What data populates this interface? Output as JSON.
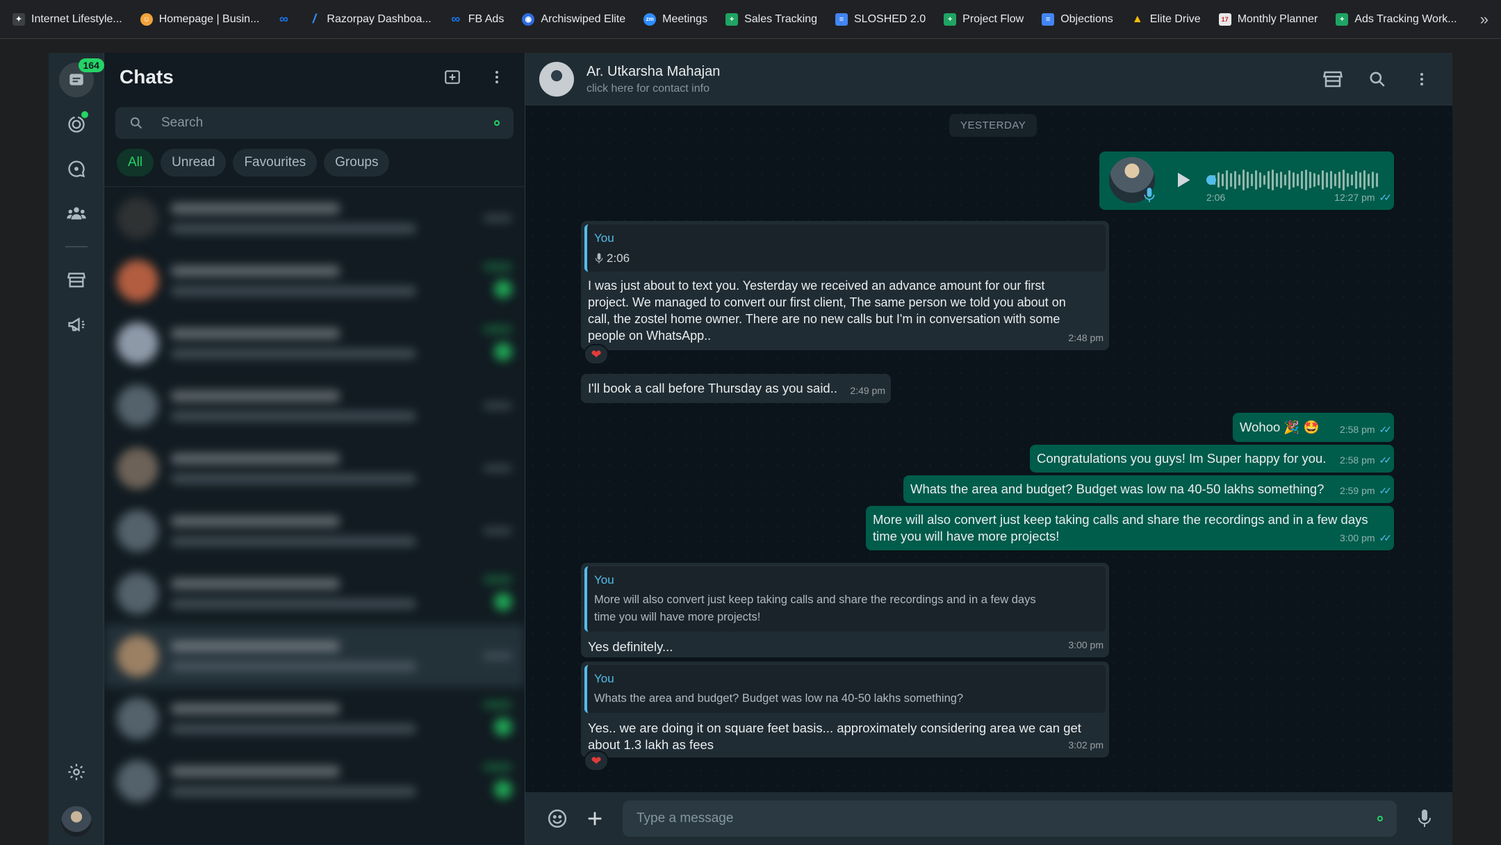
{
  "bookmarks": [
    {
      "label": "Internet Lifestyle...",
      "icon": "bird-icon",
      "color": "#5f6368"
    },
    {
      "label": "Homepage | Busin...",
      "icon": "face-icon",
      "color": "#f2a33a"
    },
    {
      "label": "",
      "icon": "meta-icon",
      "color": "#1877f2"
    },
    {
      "label": "Razorpay Dashboa...",
      "icon": "razorpay-icon",
      "color": "#3395ff"
    },
    {
      "label": "FB Ads",
      "icon": "meta-icon",
      "color": "#1877f2"
    },
    {
      "label": "Archiswiped Elite",
      "icon": "circle-logo-icon",
      "color": "#2d6cdf"
    },
    {
      "label": "Meetings",
      "icon": "zoom-icon",
      "color": "#2d8cff"
    },
    {
      "label": "Sales Tracking",
      "icon": "sheets-icon",
      "color": "#1fa463"
    },
    {
      "label": "SLOSHED 2.0",
      "icon": "docs-icon",
      "color": "#4285f4"
    },
    {
      "label": "Project Flow",
      "icon": "sheets-icon",
      "color": "#1fa463"
    },
    {
      "label": "Objections",
      "icon": "docs-icon",
      "color": "#4285f4"
    },
    {
      "label": "Elite Drive",
      "icon": "drive-icon",
      "color": "#fbbc04"
    },
    {
      "label": "Monthly Planner",
      "icon": "calendar-icon",
      "color": "#c5221f"
    },
    {
      "label": "Ads Tracking Work...",
      "icon": "sheets-icon",
      "color": "#1fa463"
    }
  ],
  "rail": {
    "unread_badge": "164"
  },
  "chatlist": {
    "title": "Chats",
    "search_placeholder": "Search",
    "filters": [
      "All",
      "Unread",
      "Favourites",
      "Groups"
    ]
  },
  "conversation": {
    "contact_name": "Ar. Utkarsha Mahajan",
    "contact_sub": "click here for contact info",
    "date_label": "YESTERDAY",
    "voice_note": {
      "duration": "2:06",
      "time": "12:27 pm"
    },
    "msg1": {
      "quote_name": "You",
      "quote_text": "2:06",
      "text": "I was just about to text you. Yesterday we received an advance amount for our first project. We managed to convert our first client, The same person we told you about on call, the zostel home owner. There are no new calls but I'm in conversation with some people on WhatsApp..",
      "time": "2:48 pm",
      "reaction": "❤"
    },
    "msg2": {
      "text": "I'll book a call before Thursday as you said..",
      "time": "2:49 pm"
    },
    "msg3": {
      "text": "Wohoo 🎉 🤩",
      "time": "2:58 pm"
    },
    "msg4": {
      "text": "Congratulations you guys! Im Super happy for you.",
      "time": "2:58 pm"
    },
    "msg5": {
      "text": "Whats the area and budget? Budget was low na 40-50 lakhs something?",
      "time": "2:59 pm"
    },
    "msg6": {
      "text": "More will also convert just keep taking calls and share the recordings and in a few days time you will have more projects!",
      "time": "3:00 pm"
    },
    "msg7": {
      "quote_name": "You",
      "quote_text": "More will also convert just keep taking calls and share the recordings and in a few days time you will have more projects!",
      "text": "Yes definitely...",
      "time": "3:00 pm"
    },
    "msg8": {
      "quote_name": "You",
      "quote_text": "Whats the area and budget? Budget was low na 40-50 lakhs something?",
      "text": "Yes.. we are doing it on square feet basis... approximately considering area we can get about 1.3 lakh as fees",
      "time": "3:02 pm",
      "reaction": "❤"
    },
    "composer_placeholder": "Type a message"
  },
  "colors": {
    "accent": "#25d366",
    "outgoing": "#005c4b",
    "incoming": "#202c33",
    "read_ticks": "#53bdeb"
  }
}
